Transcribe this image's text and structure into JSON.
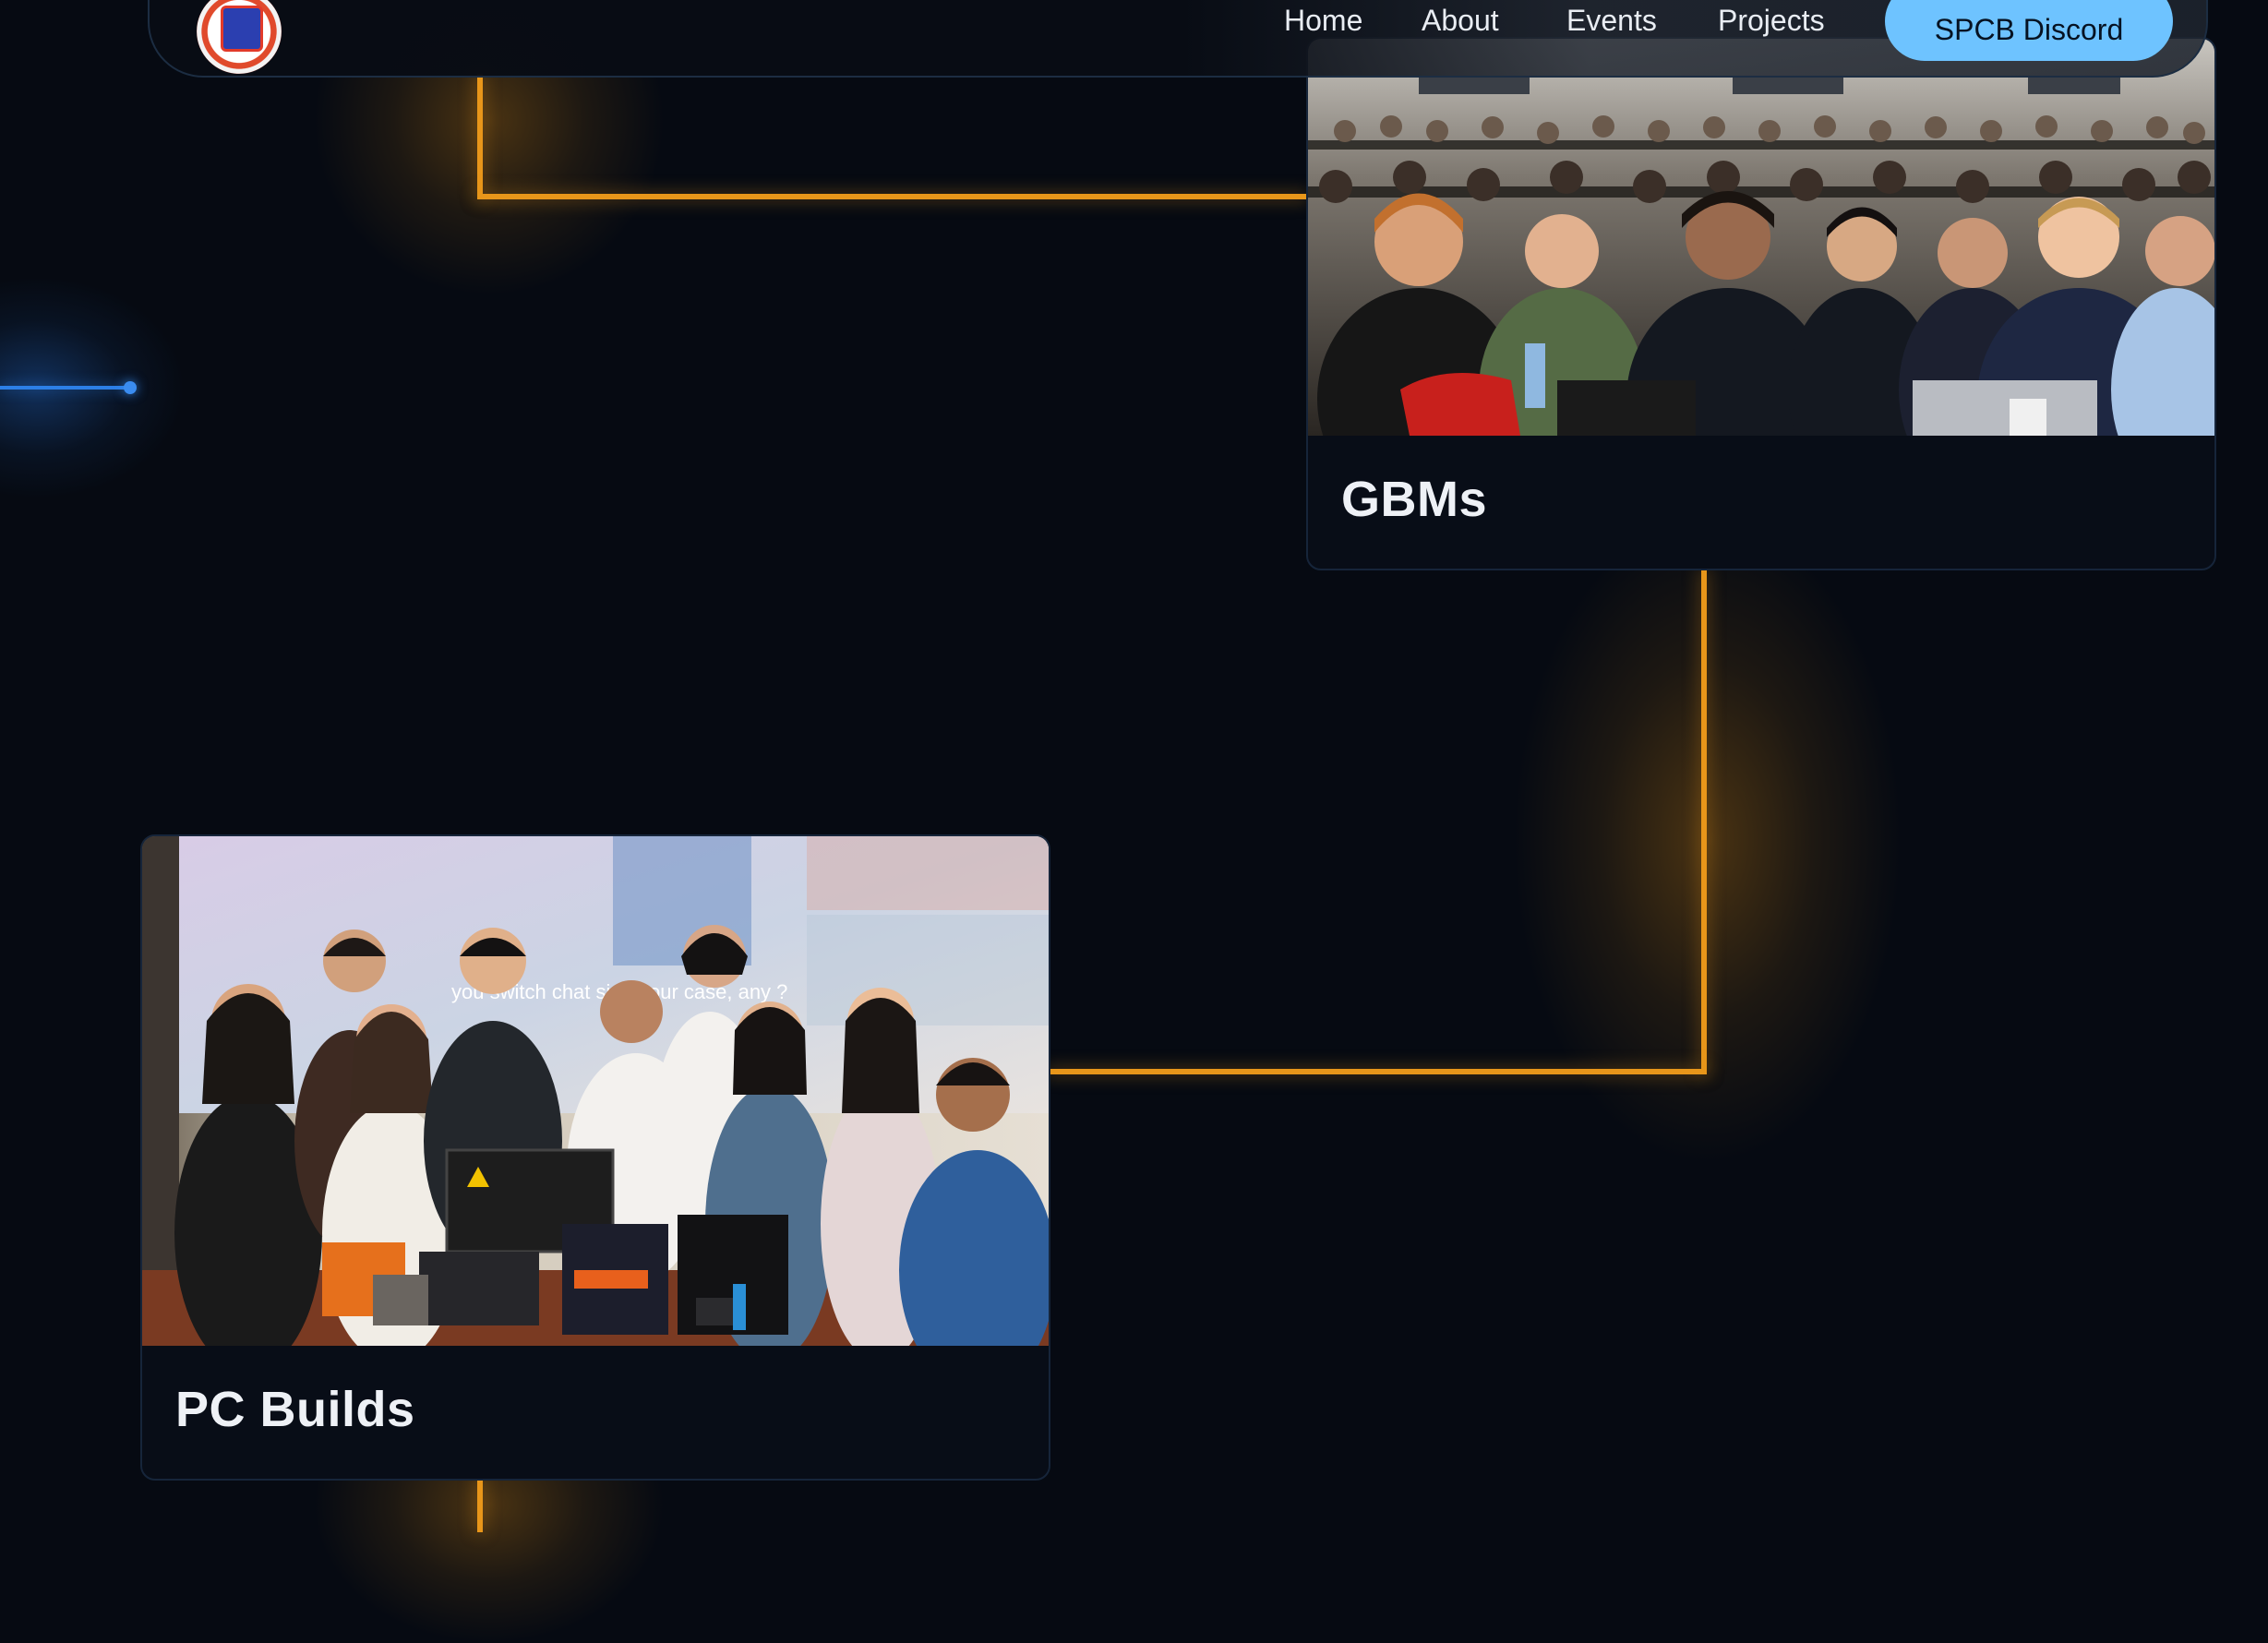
{
  "nav": {
    "logo_icon": "spcb-logo-icon",
    "links": [
      {
        "label": "Home"
      },
      {
        "label": "About"
      },
      {
        "label": "Events"
      },
      {
        "label": "Projects"
      }
    ],
    "cta_label": "SPCB Discord"
  },
  "events": [
    {
      "title": "GBMs",
      "image": "gbm-audience-photo"
    },
    {
      "title": "PC Builds",
      "image": "pc-build-group-photo"
    }
  ],
  "photo_text": {
    "screen_caption": "you switch chat   side  your case, any   ?"
  },
  "colors": {
    "background": "#060a12",
    "timeline": "#e8961a",
    "accent_blue": "#2c7fe6",
    "button": "#6ec3ff"
  }
}
